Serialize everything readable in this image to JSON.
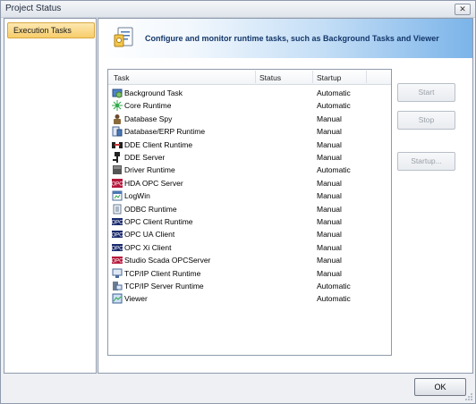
{
  "window": {
    "title": "Project Status",
    "close_label": "✕"
  },
  "sidebar": {
    "items": [
      {
        "label": "Execution Tasks"
      }
    ]
  },
  "header": {
    "text": "Configure and monitor runtime tasks, such as Background Tasks and Viewer"
  },
  "tasklist": {
    "columns": {
      "task": "Task",
      "status": "Status",
      "startup": "Startup"
    },
    "rows": [
      {
        "task": "Background Task",
        "status": "",
        "startup": "Automatic",
        "icon": "background-task-icon"
      },
      {
        "task": "Core Runtime",
        "status": "",
        "startup": "Automatic",
        "icon": "core-runtime-icon"
      },
      {
        "task": "Database Spy",
        "status": "",
        "startup": "Manual",
        "icon": "database-spy-icon"
      },
      {
        "task": "Database/ERP Runtime",
        "status": "",
        "startup": "Manual",
        "icon": "database-erp-icon"
      },
      {
        "task": "DDE Client Runtime",
        "status": "",
        "startup": "Manual",
        "icon": "dde-client-icon"
      },
      {
        "task": "DDE Server",
        "status": "",
        "startup": "Manual",
        "icon": "dde-server-icon"
      },
      {
        "task": "Driver Runtime",
        "status": "",
        "startup": "Automatic",
        "icon": "driver-runtime-icon"
      },
      {
        "task": "HDA OPC Server",
        "status": "",
        "startup": "Manual",
        "icon": "hda-opc-icon"
      },
      {
        "task": "LogWin",
        "status": "",
        "startup": "Manual",
        "icon": "logwin-icon"
      },
      {
        "task": "ODBC Runtime",
        "status": "",
        "startup": "Manual",
        "icon": "odbc-icon"
      },
      {
        "task": "OPC Client Runtime",
        "status": "",
        "startup": "Manual",
        "icon": "opc-client-icon"
      },
      {
        "task": "OPC UA Client",
        "status": "",
        "startup": "Manual",
        "icon": "opc-ua-icon"
      },
      {
        "task": "OPC Xi Client",
        "status": "",
        "startup": "Manual",
        "icon": "opc-xi-icon"
      },
      {
        "task": "Studio Scada OPCServer",
        "status": "",
        "startup": "Manual",
        "icon": "opc-server-icon"
      },
      {
        "task": "TCP/IP Client Runtime",
        "status": "",
        "startup": "Manual",
        "icon": "tcpip-client-icon"
      },
      {
        "task": "TCP/IP Server Runtime",
        "status": "",
        "startup": "Automatic",
        "icon": "tcpip-server-icon"
      },
      {
        "task": "Viewer",
        "status": "",
        "startup": "Automatic",
        "icon": "viewer-icon"
      }
    ]
  },
  "buttons": {
    "start": "Start",
    "stop": "Stop",
    "startup": "Startup...",
    "ok": "OK"
  },
  "colors": {
    "selection": "#f7cd6a",
    "header_gradient_end": "#7bb4e9",
    "disabled_text": "#9aa0a8"
  }
}
